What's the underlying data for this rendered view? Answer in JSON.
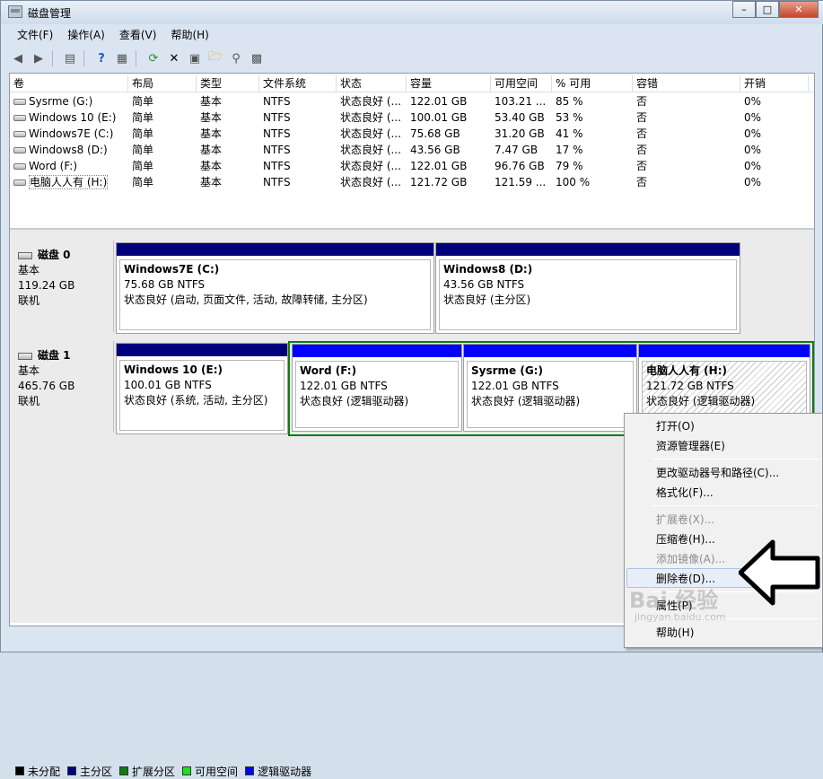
{
  "window": {
    "title": "磁盘管理"
  },
  "menubar": [
    "文件(F)",
    "操作(A)",
    "查看(V)",
    "帮助(H)"
  ],
  "volumes": {
    "columns": [
      "卷",
      "布局",
      "类型",
      "文件系统",
      "状态",
      "容量",
      "可用空间",
      "% 可用",
      "容错",
      "开销"
    ],
    "rows": [
      [
        "Sysrme (G:)",
        "简单",
        "基本",
        "NTFS",
        "状态良好 (...",
        "122.01 GB",
        "103.21 ...",
        "85 %",
        "否",
        "0%"
      ],
      [
        "Windows 10 (E:)",
        "简单",
        "基本",
        "NTFS",
        "状态良好 (...",
        "100.01 GB",
        "53.40 GB",
        "53 %",
        "否",
        "0%"
      ],
      [
        "Windows7E (C:)",
        "简单",
        "基本",
        "NTFS",
        "状态良好 (...",
        "75.68 GB",
        "31.20 GB",
        "41 %",
        "否",
        "0%"
      ],
      [
        "Windows8 (D:)",
        "简单",
        "基本",
        "NTFS",
        "状态良好 (...",
        "43.56 GB",
        "7.47 GB",
        "17 %",
        "否",
        "0%"
      ],
      [
        "Word (F:)",
        "简单",
        "基本",
        "NTFS",
        "状态良好 (...",
        "122.01 GB",
        "96.76 GB",
        "79 %",
        "否",
        "0%"
      ],
      [
        "电脑人人有 (H:)",
        "简单",
        "基本",
        "NTFS",
        "状态良好 (...",
        "121.72 GB",
        "121.59 ...",
        "100 %",
        "否",
        "0%"
      ]
    ]
  },
  "disks": [
    {
      "name": "磁盘 0",
      "type": "基本",
      "size": "119.24 GB",
      "status": "联机",
      "partitions": [
        {
          "name": "Windows7E  (C:)",
          "size": "75.68 GB NTFS",
          "status": "状态良好 (启动, 页面文件, 活动, 故障转储, 主分区)"
        },
        {
          "name": "Windows8  (D:)",
          "size": "43.56 GB NTFS",
          "status": "状态良好 (主分区)"
        }
      ]
    },
    {
      "name": "磁盘 1",
      "type": "基本",
      "size": "465.76 GB",
      "status": "联机",
      "partitions": [
        {
          "name": "Windows 10  (E:)",
          "size": "100.01 GB NTFS",
          "status": "状态良好 (系统, 活动, 主分区)"
        },
        {
          "name": "Word  (F:)",
          "size": "122.01 GB NTFS",
          "status": "状态良好 (逻辑驱动器)"
        },
        {
          "name": "Sysrme  (G:)",
          "size": "122.01 GB NTFS",
          "status": "状态良好 (逻辑驱动器)"
        },
        {
          "name": "电脑人人有  (H:)",
          "size": "121.72 GB NTFS",
          "status": "状态良好 (逻辑驱动器)"
        }
      ]
    }
  ],
  "legend": [
    {
      "label": "未分配",
      "color": "#000000"
    },
    {
      "label": "主分区",
      "color": "#00007c"
    },
    {
      "label": "扩展分区",
      "color": "#107c10"
    },
    {
      "label": "可用空间",
      "color": "#22dd22"
    },
    {
      "label": "逻辑驱动器",
      "color": "#0000ff"
    }
  ],
  "context_menu": {
    "open": "打开(O)",
    "explorer": "资源管理器(E)",
    "change_letter": "更改驱动器号和路径(C)...",
    "format": "格式化(F)...",
    "extend": "扩展卷(X)...",
    "shrink": "压缩卷(H)...",
    "mirror": "添加镜像(A)...",
    "delete": "删除卷(D)...",
    "properties": "属性(P)",
    "help": "帮助(H)"
  },
  "watermark": {
    "brand": "Bai 经验",
    "url": "jingyan.baidu.com"
  }
}
